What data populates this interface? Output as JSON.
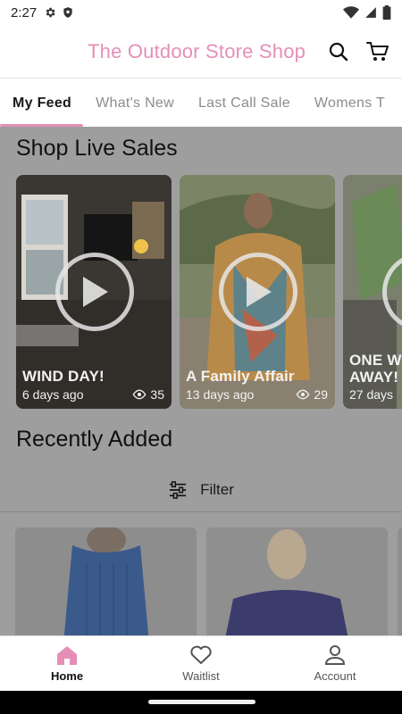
{
  "status_bar": {
    "time": "2:27"
  },
  "header": {
    "title": "The Outdoor Store Shop"
  },
  "tabs": [
    {
      "label": "My Feed",
      "active": true
    },
    {
      "label": "What's New",
      "active": false
    },
    {
      "label": "Last Call Sale",
      "active": false
    },
    {
      "label": "Womens T",
      "active": false
    }
  ],
  "live_sales": {
    "title": "Shop Live Sales",
    "cards": [
      {
        "name": "WIND DAY!",
        "age": "6 days ago",
        "views": "35"
      },
      {
        "name": "A Family Affair",
        "age": "13 days ago",
        "views": "29"
      },
      {
        "name": "ONE W AWAY!",
        "age": "27 days",
        "views": ""
      }
    ]
  },
  "recently_added": {
    "title": "Recently Added",
    "filter_label": "Filter"
  },
  "bottom_nav": [
    {
      "label": "Home",
      "active": true
    },
    {
      "label": "Waitlist",
      "active": false
    },
    {
      "label": "Account",
      "active": false
    }
  ],
  "colors": {
    "accent": "#e58fb8",
    "overlay": "#9e9e9e"
  }
}
